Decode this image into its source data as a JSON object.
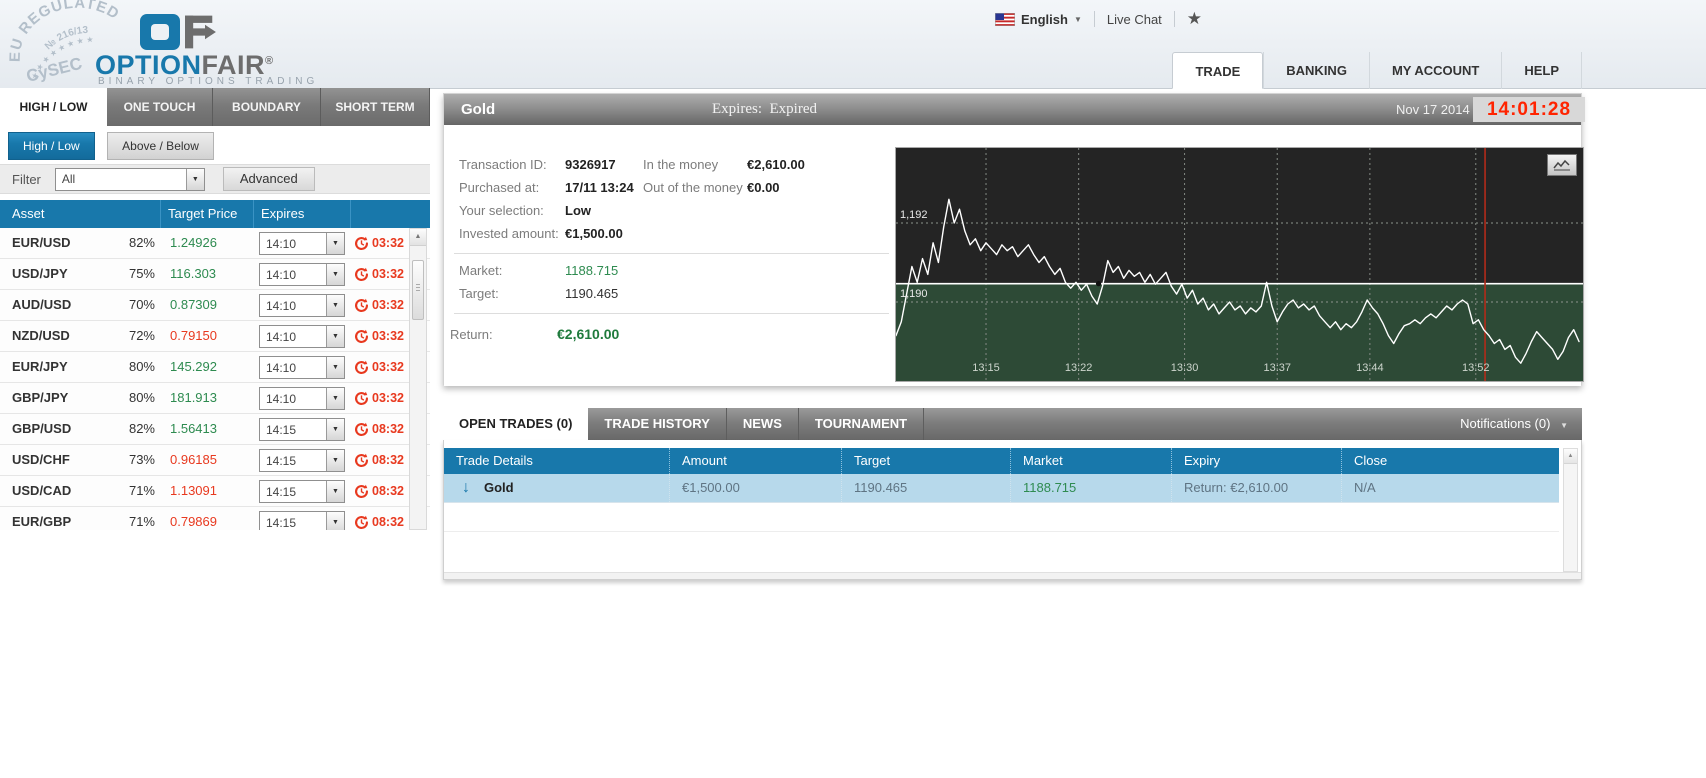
{
  "header": {
    "stamp": {
      "arc": "EU REGULATED",
      "number": "№ 216/13",
      "stars": "★ ★ ★ ★ ★ ★ ★ ★",
      "org": "CySEC"
    },
    "logo": {
      "brand_blue": "OPTION",
      "brand_gray": "FAIR",
      "reg": "®",
      "tagline": "BINARY OPTIONS TRADING"
    },
    "language": "English",
    "live_chat": "Live Chat",
    "star": "★",
    "nav": [
      {
        "label": "TRADE",
        "active": true
      },
      {
        "label": "BANKING",
        "active": false
      },
      {
        "label": "MY ACCOUNT",
        "active": false
      },
      {
        "label": "HELP",
        "active": false
      }
    ]
  },
  "left_panel": {
    "tabs": [
      {
        "label": "HIGH / LOW",
        "active": true
      },
      {
        "label": "ONE TOUCH",
        "active": false
      },
      {
        "label": "BOUNDARY",
        "active": false
      },
      {
        "label": "SHORT TERM",
        "active": false
      }
    ],
    "mode_buttons": [
      {
        "label": "High / Low",
        "active": true
      },
      {
        "label": "Above / Below",
        "active": false
      }
    ],
    "filter": {
      "label": "Filter",
      "value": "All",
      "advanced": "Advanced"
    },
    "table": {
      "headers": [
        "Asset",
        "Target Price",
        "Expires"
      ],
      "rows": [
        {
          "asset": "EUR/USD",
          "payout": "82%",
          "price": "1.24926",
          "dir": "up",
          "expiry": "14:10",
          "countdown": "03:32"
        },
        {
          "asset": "USD/JPY",
          "payout": "75%",
          "price": "116.303",
          "dir": "up",
          "expiry": "14:10",
          "countdown": "03:32"
        },
        {
          "asset": "AUD/USD",
          "payout": "70%",
          "price": "0.87309",
          "dir": "up",
          "expiry": "14:10",
          "countdown": "03:32"
        },
        {
          "asset": "NZD/USD",
          "payout": "72%",
          "price": "0.79150",
          "dir": "down",
          "expiry": "14:10",
          "countdown": "03:32"
        },
        {
          "asset": "EUR/JPY",
          "payout": "80%",
          "price": "145.292",
          "dir": "up",
          "expiry": "14:10",
          "countdown": "03:32"
        },
        {
          "asset": "GBP/JPY",
          "payout": "80%",
          "price": "181.913",
          "dir": "up",
          "expiry": "14:10",
          "countdown": "03:32"
        },
        {
          "asset": "GBP/USD",
          "payout": "82%",
          "price": "1.56413",
          "dir": "up",
          "expiry": "14:15",
          "countdown": "08:32"
        },
        {
          "asset": "USD/CHF",
          "payout": "73%",
          "price": "0.96185",
          "dir": "down",
          "expiry": "14:15",
          "countdown": "08:32"
        },
        {
          "asset": "USD/CAD",
          "payout": "71%",
          "price": "1.13091",
          "dir": "down",
          "expiry": "14:15",
          "countdown": "08:32"
        },
        {
          "asset": "EUR/GBP",
          "payout": "71%",
          "price": "0.79869",
          "dir": "down",
          "expiry": "14:15",
          "countdown": "08:32"
        }
      ]
    }
  },
  "trade_panel": {
    "title": "Gold",
    "expires_label": "Expires:",
    "expires_value": "Expired",
    "date": "Nov 17 2014",
    "time": "14:01:28",
    "details": {
      "transaction_id_label": "Transaction ID:",
      "transaction_id": "9326917",
      "purchased_at_label": "Purchased at:",
      "purchased_at": "17/11 13:24",
      "selection_label": "Your selection:",
      "selection": "Low",
      "invested_label": "Invested amount:",
      "invested": "€1,500.00",
      "in_money_label": "In the money",
      "in_money": "€2,610.00",
      "out_money_label": "Out of the money",
      "out_money": "€0.00",
      "market_label": "Market:",
      "market": "1188.715",
      "target_label": "Target:",
      "target": "1190.465",
      "return_label": "Return:",
      "return": "€2,610.00"
    }
  },
  "chart_data": {
    "type": "line",
    "title": "Gold intraday price",
    "xlim": [
      8.2,
      60.1
    ],
    "ylim": [
      1188.0,
      1193.9
    ],
    "x_ticks": [
      {
        "t": 15,
        "label": "13:15"
      },
      {
        "t": 22,
        "label": "13:22"
      },
      {
        "t": 30,
        "label": "13:30"
      },
      {
        "t": 37,
        "label": "13:37"
      },
      {
        "t": 44,
        "label": "13:44"
      },
      {
        "t": 52,
        "label": "13:52"
      }
    ],
    "y_gridlines": [
      {
        "value": 1192,
        "label": "1,192"
      },
      {
        "value": 1190,
        "label": "1,190"
      }
    ],
    "target_line": 1190.465,
    "expiry_marker_t": 52.7,
    "cross_marker_t": 23.5,
    "series": [
      {
        "name": "Gold",
        "t0": 8.2,
        "dt": 0.4,
        "values": [
          1189.15,
          1189.5,
          1190.2,
          1190.9,
          1190.5,
          1191.1,
          1190.7,
          1191.5,
          1191.0,
          1191.9,
          1192.6,
          1192.0,
          1192.35,
          1191.8,
          1191.45,
          1191.6,
          1191.3,
          1191.5,
          1191.35,
          1191.2,
          1191.45,
          1191.3,
          1191.4,
          1191.15,
          1191.3,
          1191.45,
          1191.2,
          1191.0,
          1191.15,
          1190.9,
          1190.7,
          1190.85,
          1190.5,
          1190.35,
          1190.5,
          1190.3,
          1190.45,
          1190.15,
          1189.95,
          1190.4,
          1191.05,
          1190.75,
          1190.9,
          1190.6,
          1190.8,
          1190.65,
          1190.75,
          1190.5,
          1190.7,
          1190.45,
          1190.6,
          1190.75,
          1190.4,
          1190.2,
          1190.45,
          1190.1,
          1190.3,
          1189.95,
          1190.1,
          1189.8,
          1189.95,
          1189.7,
          1189.85,
          1190.0,
          1189.8,
          1189.9,
          1189.7,
          1189.85,
          1189.75,
          1189.9,
          1190.5,
          1189.9,
          1189.5,
          1189.75,
          1189.95,
          1190.05,
          1189.85,
          1189.95,
          1189.8,
          1189.9,
          1189.65,
          1189.5,
          1189.35,
          1189.5,
          1189.3,
          1189.45,
          1189.35,
          1189.5,
          1189.75,
          1190.05,
          1189.85,
          1189.7,
          1189.45,
          1189.15,
          1188.95,
          1189.2,
          1189.4,
          1189.45,
          1189.55,
          1189.45,
          1189.6,
          1189.7,
          1189.6,
          1189.75,
          1189.9,
          1189.8,
          1189.95,
          1190.05,
          1189.95,
          1189.45,
          1189.55,
          1189.3,
          1189.15,
          1188.95,
          1189.05,
          1188.8,
          1188.9,
          1188.6,
          1188.45,
          1188.7,
          1189.0,
          1189.25,
          1189.1,
          1188.95,
          1188.8,
          1188.55,
          1188.75,
          1189.1,
          1189.3,
          1189.0
        ]
      }
    ],
    "legend": [],
    "grid": true,
    "colors": {
      "above_bg": "#242424",
      "below_bg": "#2d4a36",
      "line": "#ffffff",
      "target": "#ffffff",
      "expiry_marker": "#b22b1a"
    }
  },
  "bottom_panel": {
    "tabs": [
      {
        "label": "OPEN TRADES (0)",
        "active": true
      },
      {
        "label": "TRADE HISTORY",
        "active": false
      },
      {
        "label": "NEWS",
        "active": false
      },
      {
        "label": "TOURNAMENT",
        "active": false
      }
    ],
    "notifications": "Notifications (0)",
    "table": {
      "headers": [
        "Trade Details",
        "Amount",
        "Target",
        "Market",
        "Expiry",
        "Close"
      ],
      "rows": [
        {
          "direction": "down",
          "asset": "Gold",
          "amount": "€1,500.00",
          "target": "1190.465",
          "market": "1188.715",
          "expiry": "Return: €2,610.00",
          "close": "N/A"
        }
      ]
    }
  },
  "colors": {
    "accent_blue": "#1878ab",
    "positive_green": "#2e8b50",
    "negative_red": "#e8391f",
    "clock_red": "#ff2400"
  }
}
